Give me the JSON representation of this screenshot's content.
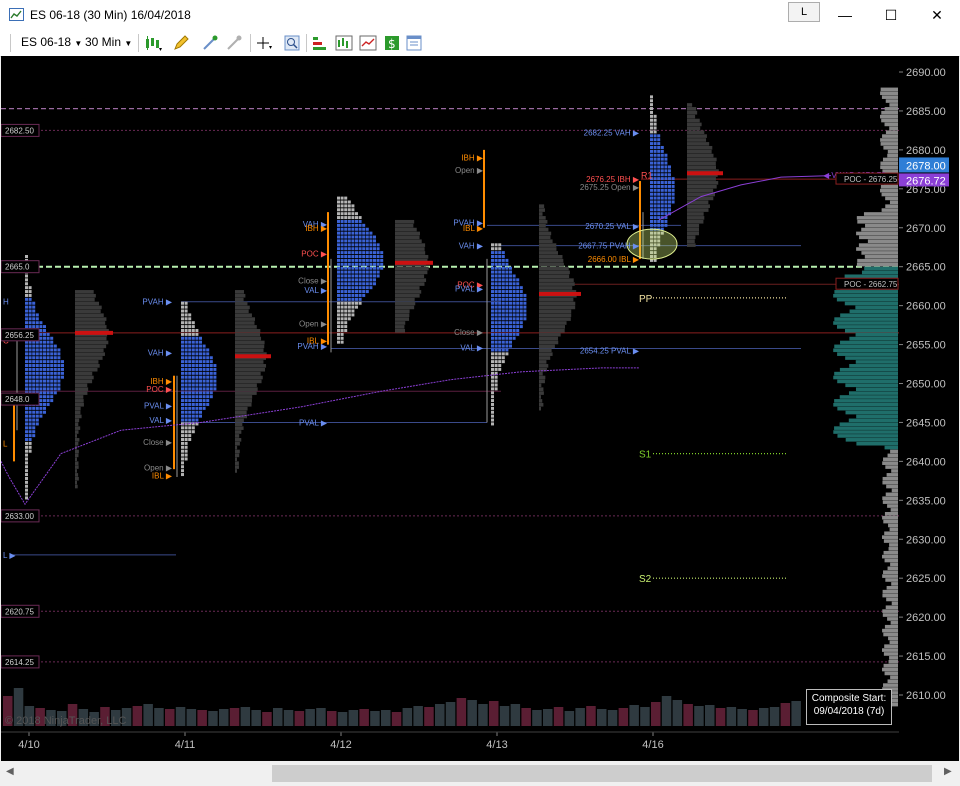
{
  "window": {
    "title": "ES 06-18 (30 Min)  16/04/2018",
    "link_label": "L",
    "minimize": "—",
    "maximize": "☐",
    "close": "✕"
  },
  "toolbar": {
    "instrument": "ES 06-18",
    "interval": "30 Min"
  },
  "price_axis": {
    "ticks": [
      "2690.00",
      "2685.00",
      "2680.00",
      "2675.00",
      "2670.00",
      "2665.00",
      "2660.00",
      "2655.00",
      "2650.00",
      "2645.00",
      "2640.00",
      "2635.00",
      "2630.00",
      "2625.00",
      "2620.00",
      "2615.00",
      "2610.00"
    ],
    "last_price": "2678.00",
    "vwap_price": "2676.72"
  },
  "date_axis": [
    "4/10",
    "4/11",
    "4/12",
    "4/13",
    "4/16"
  ],
  "left_levels": [
    "2682.50",
    "2665.0",
    "2656.25",
    "2648.0",
    "2633.00",
    "2620.75",
    "2614.25"
  ],
  "annotations": {
    "day1": [
      "H",
      "C",
      "L",
      "L"
    ],
    "day2": [
      "PVAH",
      "VAH",
      "IBH",
      "POC",
      "PVAL",
      "VAL",
      "Close",
      "Open",
      "IBL"
    ],
    "day3": [
      "VAH",
      "IBH",
      "POC",
      "Close",
      "VAL",
      "Open",
      "IBL",
      "PVAH",
      "PVAL"
    ],
    "day4": [
      "IBH",
      "Open",
      "PVAH",
      "IBL",
      "VAH",
      "POC",
      "PVAL",
      "Close",
      "VAL"
    ],
    "day5": [
      "2682.25 VAH",
      "2676.25 IBH",
      "2675.25 Open",
      "2670.25 VAL",
      "2667.75 PVAH",
      "2666.00 IBL",
      "2654.25 PVAL",
      "R1"
    ],
    "pivots": [
      "PP",
      "S1",
      "S2"
    ],
    "right_tags": [
      "VWAP 2676.72",
      "POC - 2676.25",
      "POC - 2662.75"
    ]
  },
  "composite": {
    "line1": "Composite Start:",
    "line2": "09/04/2018 (7d)"
  },
  "copyright": "© 2018 NinjaTrader, LLC",
  "colors": {
    "background": "#000000",
    "va_blue": "#3a62d6",
    "profile_grey": "#b4b4b4",
    "poc_red": "#cc1111",
    "ib_orange": "#ff8c00",
    "pivot_green": "#7ecf2a",
    "vwap_purple": "#8b3fd6",
    "composite_teal": "#1f6e6a"
  }
}
